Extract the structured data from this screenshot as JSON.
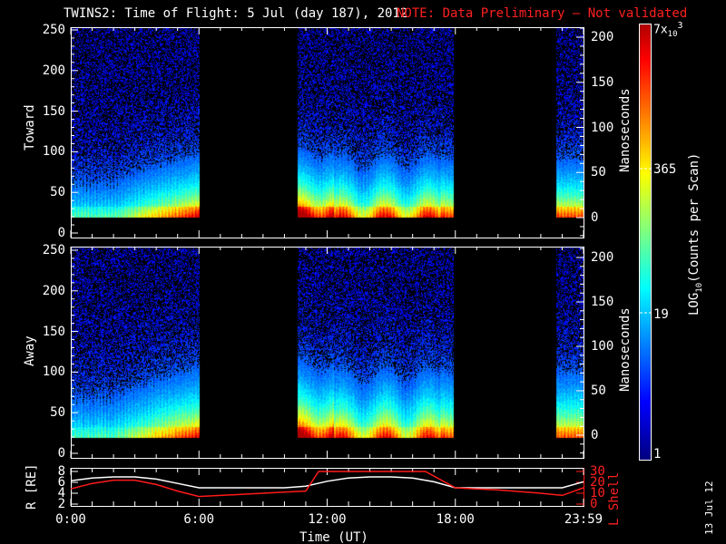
{
  "title": {
    "main": "TWINS2: Time of Flight:  5 Jul (day 187), 2012",
    "note": "NOTE: Data Preliminary — Not validated"
  },
  "footer_date": "13 Jul 12",
  "colors": {
    "note": "#ff2020",
    "orbit_R": "#ffffff",
    "orbit_L": "#ff1a1a"
  },
  "chart_data": [
    {
      "type": "heatmap",
      "panel": "Toward",
      "ylabel": "Toward",
      "ylabel_right": "Nanoseconds",
      "ylim": [
        0,
        255
      ],
      "yticks": [
        "0",
        "50",
        "100",
        "150",
        "200",
        "250"
      ],
      "yticks_right": [
        "0",
        "50",
        "100",
        "150",
        "200"
      ],
      "x_hours_data_intervals": [
        [
          0,
          6.0
        ],
        [
          10.6,
          17.9
        ],
        [
          22.7,
          24
        ]
      ],
      "z_scale": "log"
    },
    {
      "type": "heatmap",
      "panel": "Away",
      "ylabel": "Away",
      "ylabel_right": "Nanoseconds",
      "ylim": [
        0,
        255
      ],
      "yticks": [
        "0",
        "50",
        "100",
        "150",
        "200",
        "250"
      ],
      "yticks_right": [
        "0",
        "50",
        "100",
        "150",
        "200"
      ],
      "x_hours_data_intervals": [
        [
          0,
          6.0
        ],
        [
          10.6,
          17.9
        ],
        [
          22.7,
          24
        ]
      ],
      "z_scale": "log"
    },
    {
      "type": "line",
      "xlabel": "Time (UT)",
      "xticks": [
        "0:00",
        "6:00",
        "12:00",
        "18:00",
        "23:59"
      ],
      "ylabel": "R [Rₑ]",
      "ylabel_display": "R [RE]",
      "ylim": [
        2,
        8
      ],
      "yticks": [
        "2",
        "4",
        "6",
        "8"
      ],
      "ylabel_right": "L Shell",
      "ylim_right": [
        0,
        30
      ],
      "yticks_right": [
        "0",
        "10",
        "20",
        "30"
      ],
      "series": [
        {
          "name": "R",
          "axis": "left",
          "x": [
            0,
            1,
            2,
            3,
            4,
            5,
            6,
            8,
            10,
            11,
            12,
            13,
            14,
            15,
            16,
            17,
            18,
            20,
            22,
            23,
            24
          ],
          "y": [
            6.3,
            6.8,
            7.0,
            7.0,
            6.6,
            5.8,
            5.0,
            5.0,
            5.0,
            5.3,
            6.2,
            6.8,
            7.0,
            7.0,
            6.8,
            6.1,
            5.0,
            5.0,
            5.0,
            5.0,
            6.1
          ]
        },
        {
          "name": "L Shell",
          "axis": "right",
          "x": [
            0,
            1,
            2,
            3,
            4,
            5,
            6,
            8,
            10,
            11,
            11.6,
            16.6,
            18,
            20,
            22,
            23,
            24
          ],
          "y": [
            14,
            19,
            22,
            22,
            18,
            12,
            7,
            9,
            11,
            12,
            30,
            30,
            15,
            13,
            10,
            8,
            15
          ]
        }
      ]
    },
    {
      "type": "colorbar",
      "label": "LOG10(Counts per Scan)",
      "label_main": "LOG",
      "label_sub": "10",
      "label_rest": "(Counts per Scan)",
      "ticks": [
        "1",
        "19",
        "365"
      ],
      "max_label_base": "7x",
      "max_label_sub": "10",
      "max_label_sup": "3",
      "range": [
        1,
        7000
      ]
    }
  ]
}
